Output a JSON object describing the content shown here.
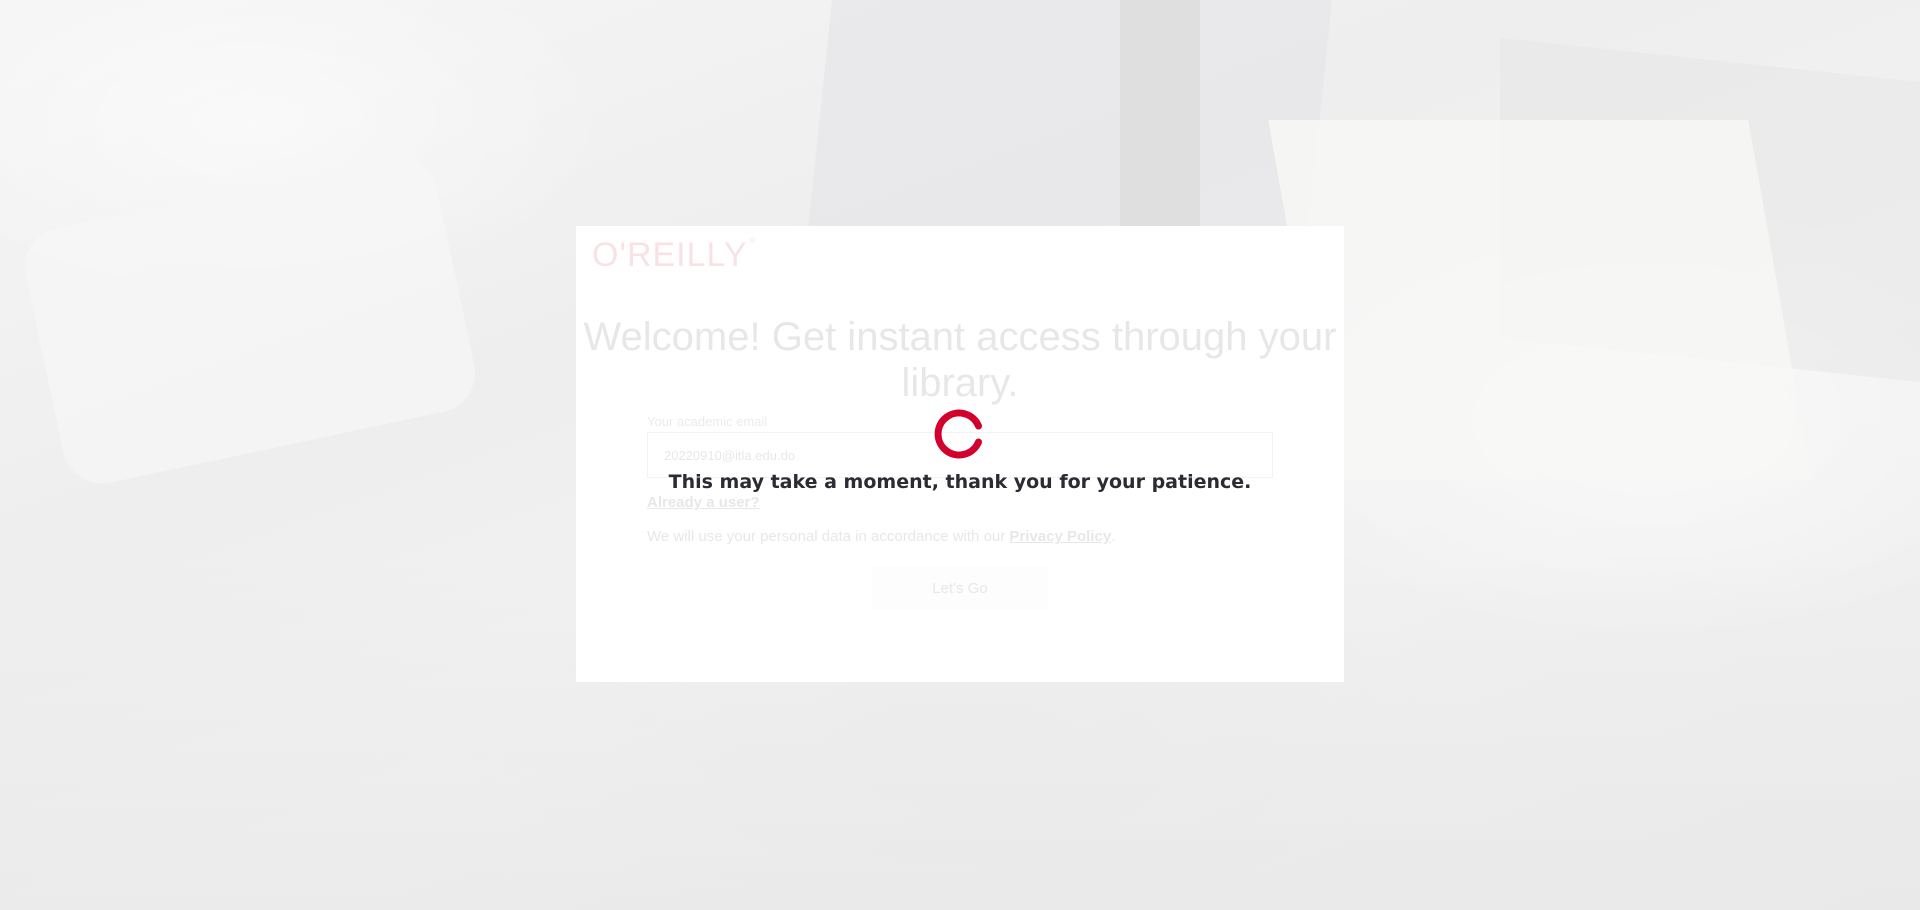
{
  "brand": {
    "logo_text": "O'REILLY",
    "logo_trademark": "®",
    "brand_color": "#d3002d"
  },
  "signup": {
    "headline": "Welcome! Get instant access through your library.",
    "email_label": "Your academic email",
    "email_value": "20220910@itla.edu.do",
    "already_user_link": "Already a user?",
    "privacy_prefix": "We will use your personal data in accordance with our ",
    "privacy_link": "Privacy Policy",
    "privacy_suffix": ".",
    "submit_label": "Let's Go"
  },
  "loading": {
    "message": "This may take a moment, thank you for your patience.",
    "spinner_color": "#d3002d",
    "icon": "spinner-icon"
  }
}
